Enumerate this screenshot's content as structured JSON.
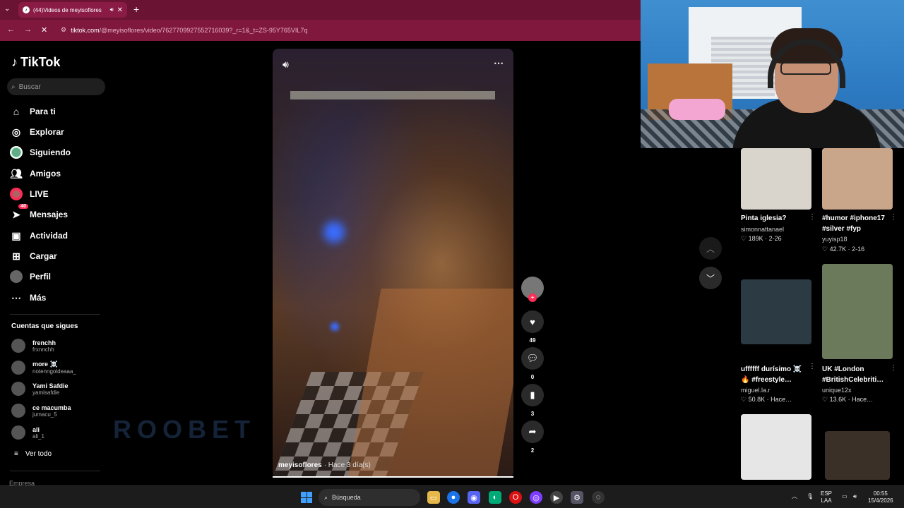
{
  "browser": {
    "tab_title": "(44)Videos de meyisoflores",
    "url_host": "tiktok.com",
    "url_path": "/@meyisoflores/video/7627709927552716039?_r=1&_t=ZS-95Y765VIL7q"
  },
  "sidebar": {
    "logo": "TikTok",
    "search_placeholder": "Buscar",
    "items": [
      {
        "label": "Para ti",
        "icon": "home-icon"
      },
      {
        "label": "Explorar",
        "icon": "compass-icon"
      },
      {
        "label": "Siguiendo",
        "icon": "following-avatar-icon"
      },
      {
        "label": "Amigos",
        "icon": "friends-icon"
      },
      {
        "label": "LIVE",
        "icon": "live-icon"
      },
      {
        "label": "Mensajes",
        "icon": "send-icon",
        "badge": "40"
      },
      {
        "label": "Actividad",
        "icon": "bell-icon"
      },
      {
        "label": "Cargar",
        "icon": "upload-icon"
      },
      {
        "label": "Perfil",
        "icon": "profile-avatar-icon"
      },
      {
        "label": "Más",
        "icon": "more-icon"
      }
    ],
    "following_title": "Cuentas que sigues",
    "accounts": [
      {
        "name": "frenchh",
        "handle": "frxnnchh"
      },
      {
        "name": "more ☠️",
        "handle": "notenngoldeaaa_"
      },
      {
        "name": "Yami Safdie",
        "handle": "yamisafdie"
      },
      {
        "name": "ce macumba",
        "handle": "jumacu_5"
      },
      {
        "name": "ali",
        "handle": "ali_1"
      }
    ],
    "see_all": "Ver todo",
    "footer": "Empresa",
    "watermark": "ROOBET"
  },
  "video": {
    "author": "meyisoflores",
    "time": "· Hace 3 día(s)",
    "progress": 1.0,
    "likes": "49",
    "comments": "0",
    "saves": "3",
    "shares": "2"
  },
  "recommended": [
    {
      "title": "Pinta iglesia?",
      "author": "simonnattanael",
      "stats": "♡ 189K · 2-26",
      "thumb": "#d9d4cc"
    },
    {
      "title": "#humor #iphone17 #silver #fyp",
      "author": "yuyisp18",
      "stats": "♡ 42.7K · 2-16",
      "thumb": "#c9a58a"
    },
    {
      "title": "uffffff durísimo ☠️ 🔥 #freestyle…",
      "author": "miguel.la.r",
      "stats": "♡ 50.8K · Hace…",
      "thumb": "#2c3a44"
    },
    {
      "title": "UK #London #BritishCelebriti…",
      "author": "unique12x",
      "stats": "♡ 13.6K · Hace…",
      "thumb": "#6b7a5a"
    },
    {
      "title": "",
      "author": "",
      "stats": "",
      "thumb": "#e6e6e6"
    },
    {
      "title": "",
      "author": "",
      "stats": "",
      "thumb": "#3a3028"
    }
  ],
  "taskbar": {
    "search": "Búsqueda",
    "lang": "ESP",
    "lang2": "LAA",
    "time": "00:55",
    "date": "15/4/2026"
  }
}
